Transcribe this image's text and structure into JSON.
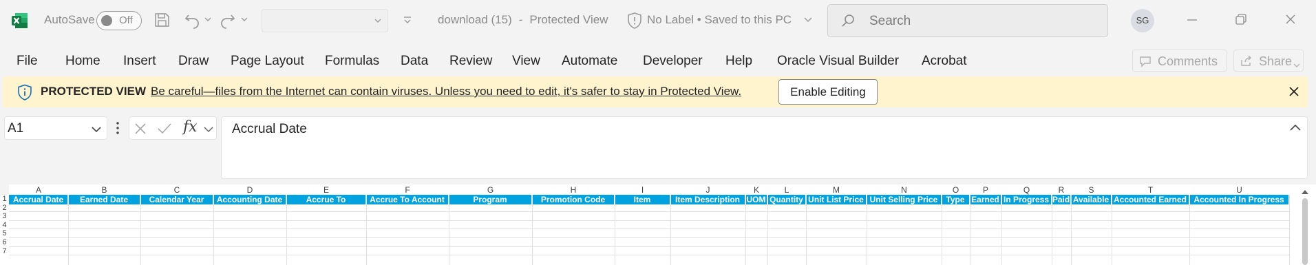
{
  "titlebar": {
    "autosave_label": "AutoSave",
    "autosave_state": "Off",
    "doc_name": "download (15)",
    "doc_mode": "Protected View",
    "sensitivity": "No Label",
    "save_status": "Saved to this PC",
    "search_placeholder": "Search",
    "avatar_initials": "SG"
  },
  "ribbon": {
    "tabs": [
      "File",
      "Home",
      "Insert",
      "Draw",
      "Page Layout",
      "Formulas",
      "Data",
      "Review",
      "View",
      "Automate",
      "Developer",
      "Help",
      "Oracle Visual Builder",
      "Acrobat"
    ],
    "comments_label": "Comments",
    "share_label": "Share"
  },
  "protected_view": {
    "title": "PROTECTED VIEW",
    "message": "Be careful—files from the Internet can contain viruses. Unless you need to edit, it's safer to stay in Protected View.",
    "enable_button": "Enable Editing"
  },
  "formula_bar": {
    "name_box": "A1",
    "fx": "fx",
    "formula": "Accrual Date"
  },
  "grid": {
    "columns": [
      "A",
      "B",
      "C",
      "D",
      "E",
      "F",
      "G",
      "H",
      "I",
      "J",
      "K",
      "L",
      "M",
      "N",
      "O",
      "P",
      "Q",
      "R",
      "S",
      "T",
      "U"
    ],
    "headers": [
      "Accrual Date",
      "Earned Date",
      "Calendar Year",
      "Accounting Date",
      "Accrue To",
      "Accrue To Account",
      "Program",
      "Promotion Code",
      "Item",
      "Item Description",
      "UOM",
      "Quantity",
      "Unit List Price",
      "Unit Selling Price",
      "Type",
      "Earned",
      "In Progress",
      "Paid",
      "Available",
      "Accounted Earned",
      "Accounted In Progress"
    ],
    "rows": [
      "1",
      "2",
      "3",
      "4",
      "5",
      "6",
      "7"
    ]
  },
  "colors": {
    "header_fill": "#00a3e0",
    "protected_bar": "#fff4ce",
    "excel_green": "#107c41"
  }
}
